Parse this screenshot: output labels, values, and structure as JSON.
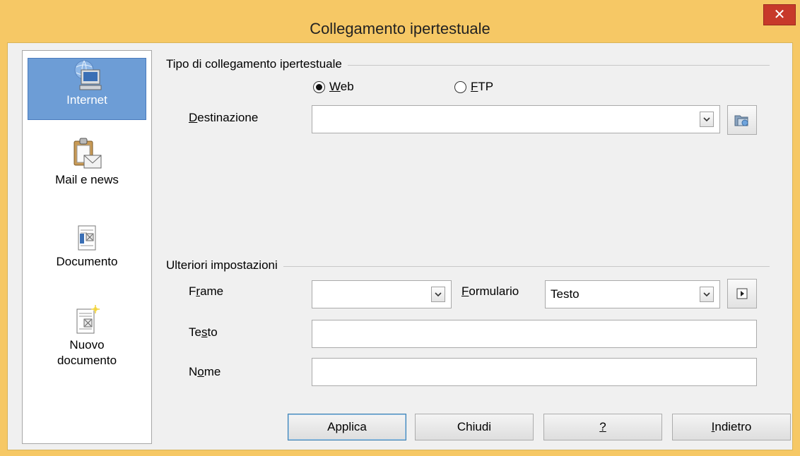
{
  "window": {
    "title": "Collegamento ipertestuale",
    "close_label": "✕"
  },
  "sidebar": {
    "items": [
      {
        "label": "Internet",
        "icon": "globe-computer-icon",
        "selected": true
      },
      {
        "label": "Mail e news",
        "icon": "clipboard-mail-icon",
        "selected": false
      },
      {
        "label": "Documento",
        "icon": "document-icon",
        "selected": false
      },
      {
        "label": "Nuovo",
        "label2": "documento",
        "icon": "new-document-icon",
        "selected": false
      }
    ]
  },
  "hyperlink_type": {
    "group_label": "Tipo di collegamento ipertestuale",
    "options": [
      {
        "accel": "W",
        "rest": "eb",
        "checked": true
      },
      {
        "accel": "F",
        "rest": "TP",
        "checked": false
      }
    ],
    "destination": {
      "pre": "",
      "accel": "D",
      "rest": "estinazione",
      "value": ""
    }
  },
  "further_settings": {
    "group_label": "Ulteriori impostazioni",
    "frame": {
      "pre": "F",
      "accel": "r",
      "rest": "ame",
      "value": ""
    },
    "form": {
      "pre": "",
      "accel": "F",
      "rest": "ormulario",
      "value": "Testo"
    },
    "text": {
      "pre": "Te",
      "accel": "s",
      "rest": "to",
      "value": ""
    },
    "name": {
      "pre": "N",
      "accel": "o",
      "rest": "me",
      "value": ""
    }
  },
  "buttons": {
    "apply": "Applica",
    "close": "Chiudi",
    "help": "?",
    "back_accel": "I",
    "back_rest": "ndietro"
  }
}
